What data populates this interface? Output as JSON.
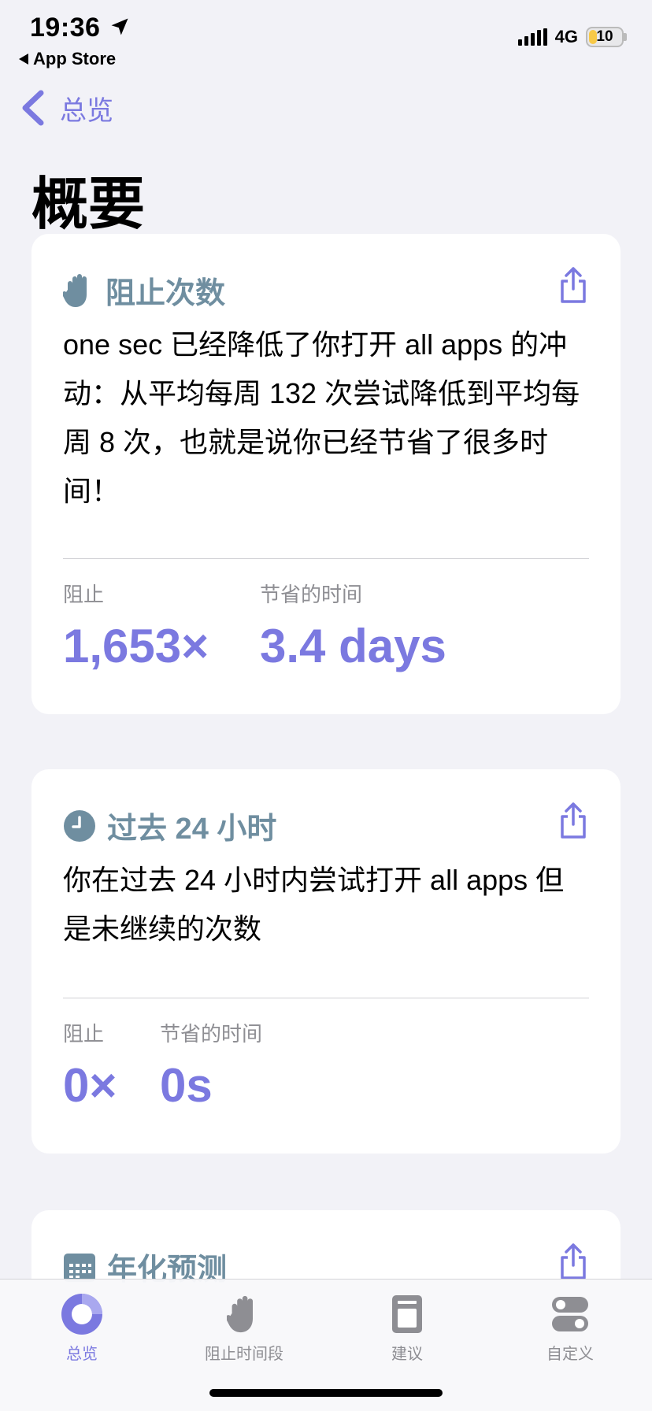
{
  "status_bar": {
    "time": "19:36",
    "back_app": "App Store",
    "network": "4G",
    "battery": "10"
  },
  "nav": {
    "back_label": "总览"
  },
  "page": {
    "title": "概要"
  },
  "colors": {
    "accent": "#7b79e0",
    "section_heading": "#6f8ea0",
    "background": "#f2f2f7",
    "card": "#ffffff"
  },
  "cards": [
    {
      "icon": "hand-stop-icon",
      "title": "阻止次数",
      "description": "one sec 已经降低了你打开 all apps 的冲动：从平均每周 132 次尝试降低到平均每周 8 次，也就是说你已经节省了很多时间！",
      "stats": [
        {
          "label": "阻止",
          "value": "1,653×"
        },
        {
          "label": "节省的时间",
          "value": "3.4 days"
        }
      ]
    },
    {
      "icon": "clock-icon",
      "title": "过去 24 小时",
      "description": "你在过去 24 小时内尝试打开 all apps 但是未继续的次数",
      "stats": [
        {
          "label": "阻止",
          "value": "0×"
        },
        {
          "label": "节省的时间",
          "value": "0s"
        }
      ]
    },
    {
      "icon": "calendar-icon",
      "title": "年化预测"
    }
  ],
  "tabs": [
    {
      "label": "总览",
      "icon": "overview-ring-icon",
      "active": true
    },
    {
      "label": "阻止时间段",
      "icon": "hand-icon",
      "active": false
    },
    {
      "label": "建议",
      "icon": "book-icon",
      "active": false
    },
    {
      "label": "自定义",
      "icon": "toggles-icon",
      "active": false
    }
  ]
}
